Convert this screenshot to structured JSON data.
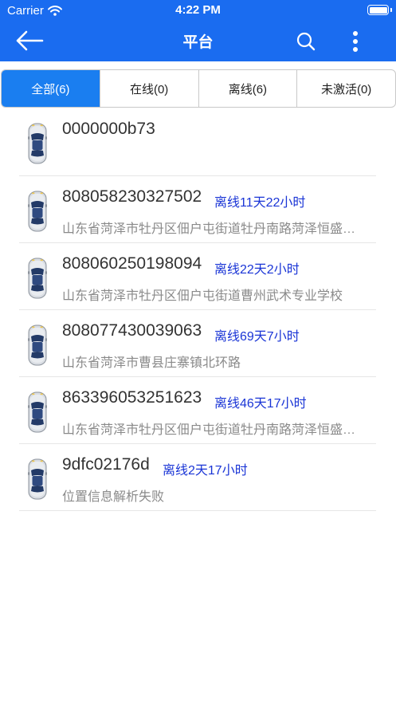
{
  "status_bar": {
    "carrier": "Carrier",
    "time": "4:22 PM"
  },
  "nav": {
    "title": "平台"
  },
  "tabs": [
    {
      "label": "全部(6)",
      "active": true
    },
    {
      "label": "在线(0)",
      "active": false
    },
    {
      "label": "离线(6)",
      "active": false
    },
    {
      "label": "未激活(0)",
      "active": false
    }
  ],
  "devices": [
    {
      "id": "0000000b73",
      "status": "",
      "address": ""
    },
    {
      "id": "808058230327502",
      "status": "离线11天22小时",
      "address": "山东省菏泽市牡丹区佃户屯街道牡丹南路菏泽恒盛…"
    },
    {
      "id": "808060250198094",
      "status": "离线22天2小时",
      "address": "山东省菏泽市牡丹区佃户屯街道曹州武术专业学校"
    },
    {
      "id": "808077430039063",
      "status": "离线69天7小时",
      "address": "山东省菏泽市曹县庄寨镇北环路"
    },
    {
      "id": "863396053251623",
      "status": "离线46天17小时",
      "address": "山东省菏泽市牡丹区佃户屯街道牡丹南路菏泽恒盛…"
    },
    {
      "id": "9dfc02176d",
      "status": "离线2天17小时",
      "address": "位置信息解析失败"
    }
  ],
  "colors": {
    "primary": "#1a6cf0",
    "tab_active": "#1a7ef0",
    "status_text": "#1a35d6"
  },
  "icons": {
    "back": "arrow-left-icon",
    "search": "search-icon",
    "more": "more-vertical-icon",
    "car": "car-icon",
    "wifi": "wifi-icon",
    "battery": "battery-icon"
  }
}
